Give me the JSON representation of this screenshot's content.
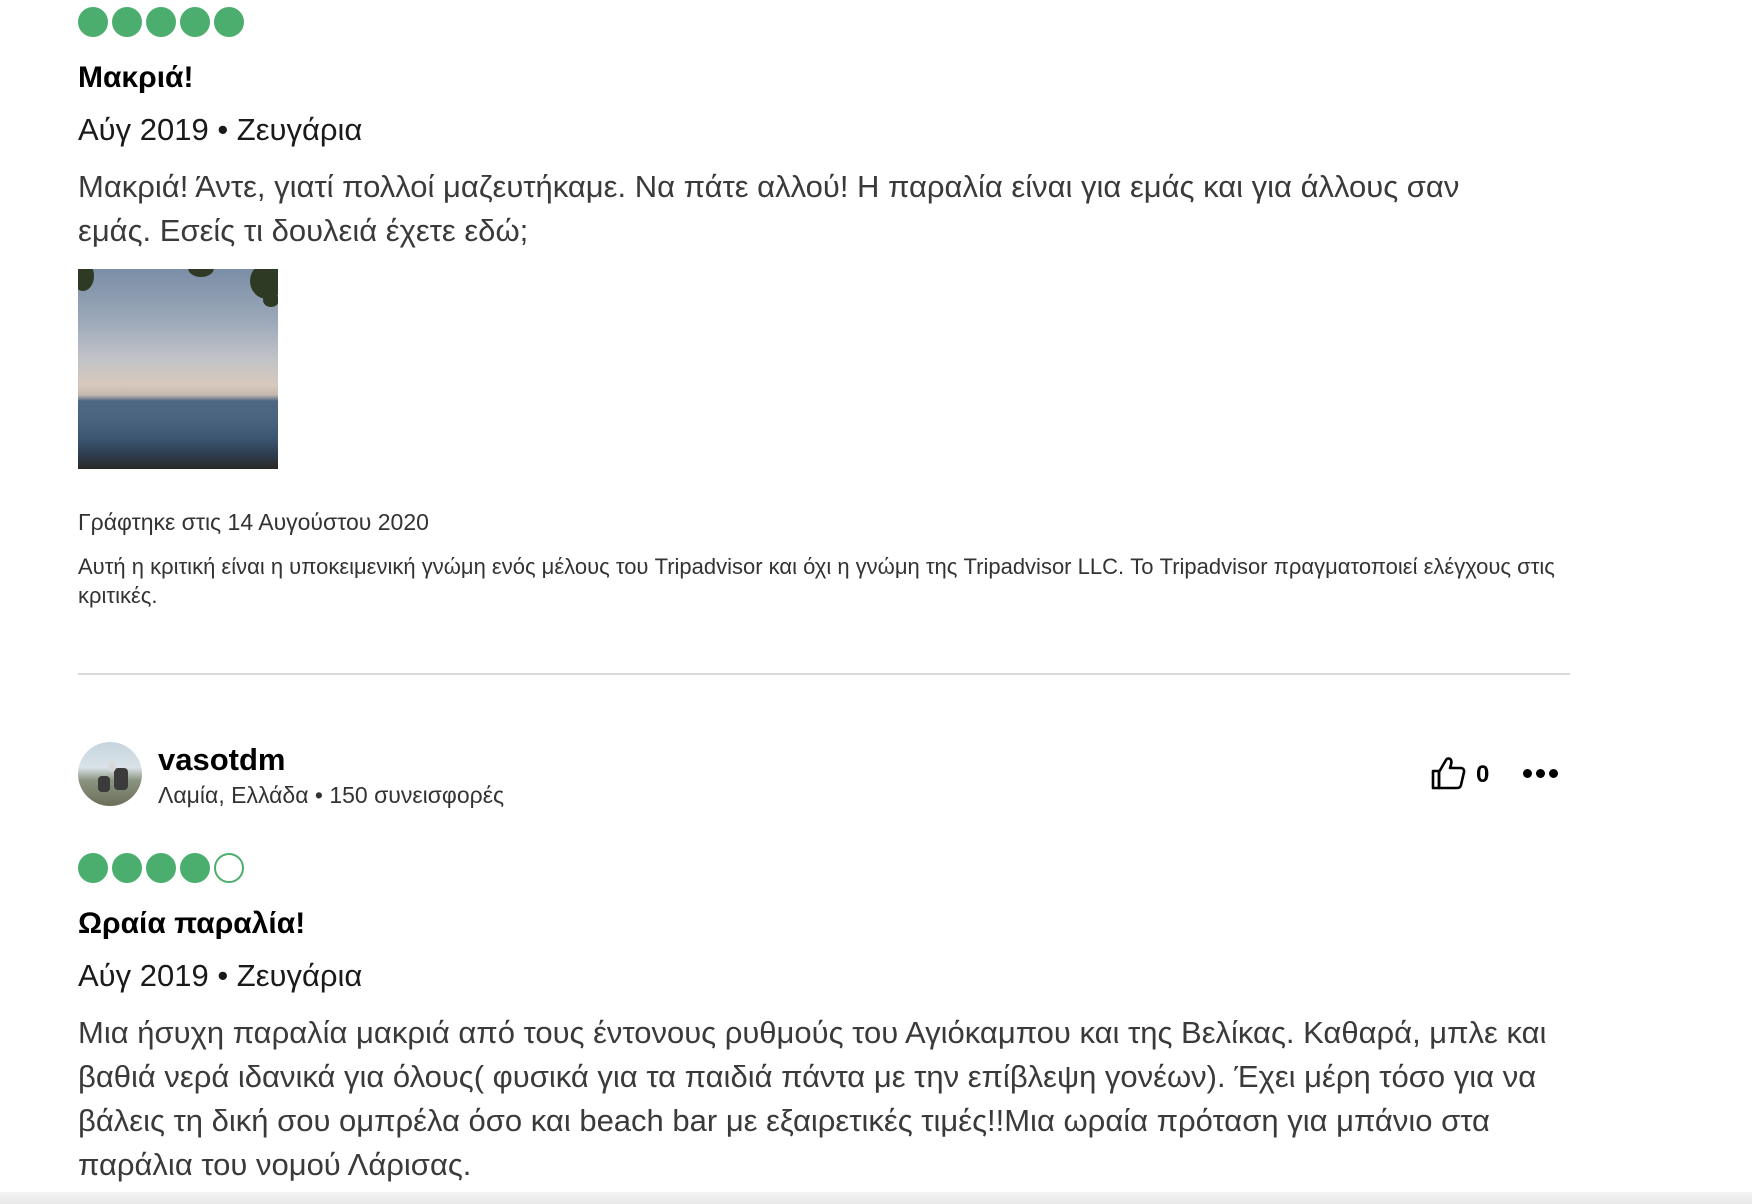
{
  "review1": {
    "rating": 5,
    "max_rating": 5,
    "title": "Μακριά!",
    "meta": "Αύγ 2019 • Ζευγάρια",
    "body": "Μακριά! Άντε, γιατί πολλοί μαζευτήκαμε. Να πάτε αλλού! Η παραλία είναι για εμάς και για άλλους σαν εμάς. Εσείς τι δουλειά έχετε εδώ;",
    "written": "Γράφτηκε στις 14 Αυγούστου 2020",
    "disclaimer": "Αυτή η κριτική είναι η υποκειμενική γνώμη ενός μέλους του Tripadvisor και όχι η γνώμη της Tripadvisor LLC. Το Tripadvisor πραγματοποιεί ελέγχους στις κριτικές."
  },
  "review2": {
    "username": "vasotdm",
    "member_info": "Λαμία, Ελλάδα • 150 συνεισφορές",
    "helpful_votes": "0",
    "rating": 4,
    "max_rating": 5,
    "title": "Ωραία παραλία!",
    "meta": "Αύγ 2019 • Ζευγάρια",
    "body": "Μια ήσυχη παραλία μακριά από τους έντονους ρυθμούς του Αγιόκαμπου και της Βελίκας. Καθαρά, μπλε και βαθιά νερά ιδανικά για όλους( φυσικά για τα παιδιά πάντα με την επίβλεψη γονέων). Έχει μέρη τόσο για να βάλεις τη δική σου ομπρέλα όσο και beach bar με εξαιρετικές τιμές!!Μια ωραία πρόταση για μπάνιο στα παράλια του νομού Λάρισας."
  },
  "colors": {
    "bubble": "#4cae6e",
    "divider": "#d9d9d9"
  },
  "icons": {
    "helpful": "thumbs-up-icon",
    "more": "more-options-icon"
  }
}
